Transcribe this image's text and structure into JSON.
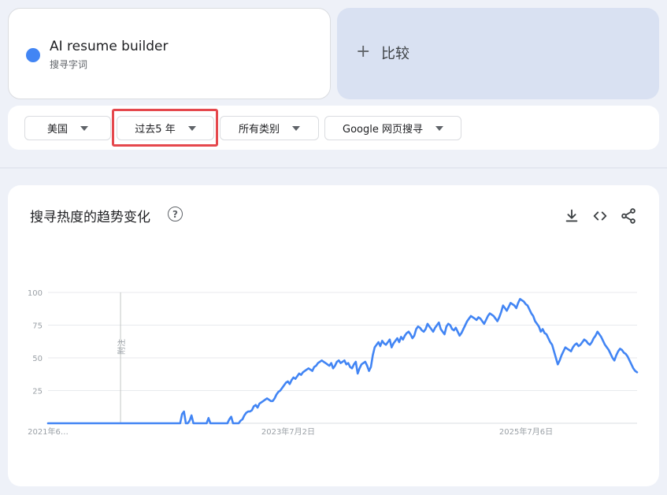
{
  "search_term": {
    "title": "AI resume builder",
    "type_label": "搜寻字词",
    "color": "#4285f4"
  },
  "compare": {
    "label": "比较"
  },
  "filters": {
    "region": "美国",
    "time_range": "过去5 年",
    "category": "所有类别",
    "search_type": "Google 网页搜寻"
  },
  "chart_section": {
    "title": "搜寻热度的趋势变化",
    "help_icon": "help-circle-icon",
    "tools": [
      "download-icon",
      "embed-code-icon",
      "share-icon"
    ]
  },
  "chart_data": {
    "type": "line",
    "ylim": [
      0,
      100
    ],
    "yticks": [
      25,
      50,
      75,
      100
    ],
    "x_tick_labels": [
      "2021年6…",
      "2023年7月2日",
      "2025年7月6日"
    ],
    "x_tick_dates": [
      "2021-06-20",
      "2023-07-02",
      "2025-07-06"
    ],
    "x_range": [
      "2021-06-20",
      "2026-06-14"
    ],
    "annotation": {
      "text": "附注",
      "date": "2022-01-30"
    },
    "grid": true,
    "line_color": "#4285f4",
    "series": [
      {
        "name": "AI resume builder",
        "values": [
          0,
          0,
          0,
          0,
          0,
          0,
          0,
          0,
          0,
          0,
          0,
          0,
          0,
          0,
          0,
          0,
          0,
          0,
          0,
          0,
          0,
          0,
          0,
          0,
          0,
          0,
          0,
          0,
          0,
          0,
          0,
          0,
          0,
          0,
          0,
          0,
          0,
          0,
          0,
          0,
          0,
          0,
          0,
          0,
          0,
          0,
          0,
          0,
          0,
          0,
          0,
          0,
          0,
          0,
          0,
          0,
          0,
          0,
          0,
          0,
          0,
          0,
          0,
          0,
          0,
          0,
          0,
          0,
          0,
          0,
          0,
          7,
          9,
          0,
          0,
          2,
          6,
          0,
          0,
          0,
          0,
          0,
          0,
          0,
          0,
          4,
          0,
          0,
          0,
          0,
          0,
          0,
          0,
          0,
          0,
          0,
          3,
          5,
          0,
          0,
          0,
          0,
          2,
          3,
          6,
          8,
          9,
          9,
          10,
          13,
          14,
          12,
          15,
          16,
          17,
          18,
          19,
          18,
          17,
          17,
          19,
          22,
          24,
          25,
          27,
          29,
          31,
          32,
          30,
          33,
          35,
          34,
          36,
          38,
          37,
          39,
          40,
          41,
          42,
          41,
          40,
          43,
          44,
          46,
          47,
          48,
          47,
          46,
          45,
          44,
          46,
          42,
          44,
          47,
          48,
          46,
          47,
          48,
          45,
          46,
          43,
          42,
          45,
          47,
          38,
          42,
          45,
          46,
          47,
          44,
          40,
          43,
          52,
          58,
          60,
          62,
          59,
          63,
          61,
          60,
          62,
          64,
          58,
          61,
          63,
          65,
          62,
          66,
          64,
          67,
          69,
          70,
          68,
          65,
          67,
          72,
          74,
          73,
          71,
          70,
          72,
          76,
          74,
          72,
          70,
          73,
          75,
          77,
          72,
          70,
          68,
          74,
          76,
          75,
          72,
          71,
          73,
          70,
          67,
          69,
          72,
          75,
          78,
          80,
          82,
          81,
          80,
          79,
          81,
          80,
          78,
          76,
          79,
          82,
          84,
          83,
          82,
          80,
          78,
          81,
          85,
          90,
          88,
          86,
          89,
          92,
          91,
          90,
          88,
          92,
          95,
          94,
          93,
          91,
          90,
          87,
          84,
          82,
          78,
          76,
          74,
          70,
          72,
          69,
          68,
          65,
          62,
          60,
          55,
          50,
          45,
          48,
          52,
          55,
          58,
          57,
          56,
          55,
          58,
          60,
          61,
          59,
          60,
          62,
          64,
          63,
          61,
          60,
          62,
          65,
          67,
          70,
          68,
          66,
          63,
          60,
          58,
          56,
          53,
          50,
          48,
          52,
          55,
          57,
          56,
          54,
          53,
          51,
          48,
          45,
          42,
          40,
          39
        ]
      }
    ]
  }
}
